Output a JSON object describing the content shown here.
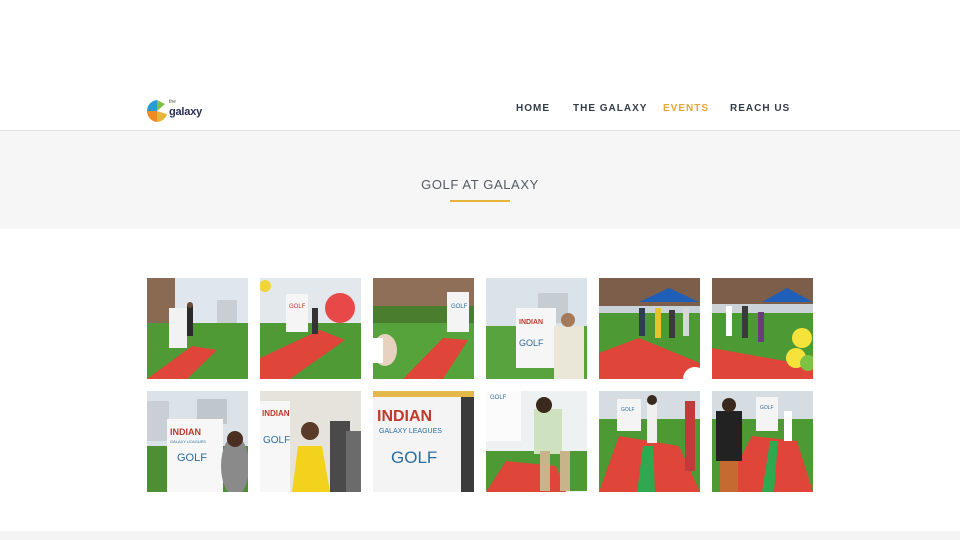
{
  "brand": {
    "logo_small": "the",
    "logo_word": "galaxy",
    "colors": {
      "orange": "#f08a24",
      "green": "#7dc242",
      "blue": "#2b9bd6",
      "navy": "#2b2f5a"
    }
  },
  "nav": {
    "items": [
      {
        "label": "HOME",
        "active": false
      },
      {
        "label": "THE GALAXY",
        "active": false
      },
      {
        "label": "EVENTS",
        "active": true
      },
      {
        "label": "REACH US",
        "active": false
      }
    ],
    "active_color": "#e8a634",
    "text_color": "#333d47"
  },
  "hero": {
    "title": "GOLF AT GALAXY",
    "underline_color": "#e8b43a"
  },
  "gallery": {
    "photos": [
      {
        "kind": "putt-banner-left",
        "banner_text": ""
      },
      {
        "kind": "putt-balloon",
        "banner_text": "GOLF"
      },
      {
        "kind": "crouch",
        "banner_text": "GOLF"
      },
      {
        "kind": "man-banner",
        "banner_text": "INDIAN GOLF"
      },
      {
        "kind": "tent-crowd",
        "banner_text": ""
      },
      {
        "kind": "tent-balloons",
        "banner_text": ""
      },
      {
        "kind": "woman-banner",
        "banner_text": "INDIAN GALAXY LEAGUES GOLF"
      },
      {
        "kind": "yellow-dress",
        "banner_text": "INDIAN GOLF"
      },
      {
        "kind": "banner-closeup",
        "banner_text": "INDIAN GALAXY LEAGUES GOLF"
      },
      {
        "kind": "putting-man",
        "banner_text": "GOLF"
      },
      {
        "kind": "green-strip-woman",
        "banner_text": "GOLF"
      },
      {
        "kind": "green-strip-man",
        "banner_text": "GOLF"
      }
    ]
  }
}
